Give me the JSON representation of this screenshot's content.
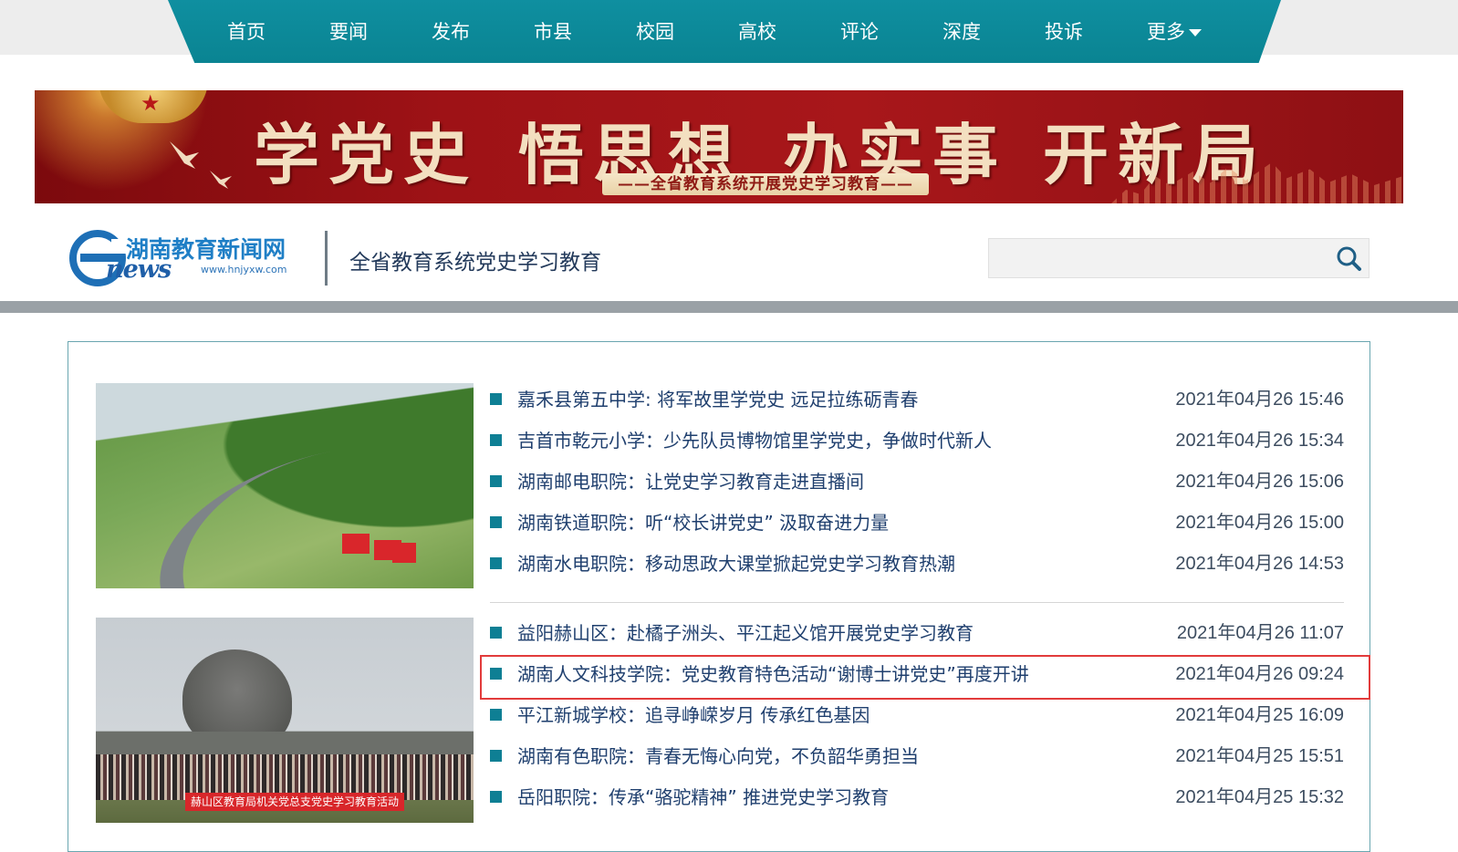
{
  "nav": {
    "items": [
      "首页",
      "要闻",
      "发布",
      "市县",
      "校园",
      "高校",
      "评论",
      "深度",
      "投诉"
    ],
    "more_label": "更多"
  },
  "banner": {
    "slogans": [
      "学党史",
      "悟思想",
      "办实事",
      "开新局"
    ],
    "subtitle": "——全省教育系统开展党史学习教育——"
  },
  "header": {
    "logo_name": "湖南教育新闻网",
    "logo_enews": "news",
    "logo_url": "www.hnjyxw.com",
    "section_title": "全省教育系统党史学习教育"
  },
  "search": {
    "value": "",
    "placeholder": ""
  },
  "photos": {
    "photo2_banner_text": "赫山区教育局机关党总支党史学习教育活动"
  },
  "news_group1": [
    {
      "title": "嘉禾县第五中学: 将军故里学党史 远足拉练砺青春",
      "date": "2021年04月26 15:46"
    },
    {
      "title": "吉首市乾元小学：少先队员博物馆里学党史，争做时代新人",
      "date": "2021年04月26 15:34"
    },
    {
      "title": "湖南邮电职院：让党史学习教育走进直播间",
      "date": "2021年04月26 15:06"
    },
    {
      "title": "湖南铁道职院：听“校长讲党史” 汲取奋进力量",
      "date": "2021年04月26 15:00"
    },
    {
      "title": "湖南水电职院：移动思政大课堂掀起党史学习教育热潮",
      "date": "2021年04月26 14:53"
    }
  ],
  "news_group2": [
    {
      "title": "益阳赫山区：赴橘子洲头、平江起义馆开展党史学习教育",
      "date": "2021年04月26 11:07"
    },
    {
      "title": "湖南人文科技学院：党史教育特色活动“谢博士讲党史”再度开讲",
      "date": "2021年04月26 09:24"
    },
    {
      "title": "平江新城学校：追寻峥嵘岁月 传承红色基因",
      "date": "2021年04月25 16:09"
    },
    {
      "title": "湖南有色职院：青春无悔心向党，不负韶华勇担当",
      "date": "2021年04月25 15:51"
    },
    {
      "title": "岳阳职院：传承“骆驼精神” 推进党史学习教育",
      "date": "2021年04月25 15:32"
    }
  ],
  "colors": {
    "nav_bg": "#0a8492",
    "banner_red": "#a8171a",
    "bullet": "#0e7f94",
    "highlight_border": "#e23b3b",
    "title_text": "#1f3f6e"
  }
}
